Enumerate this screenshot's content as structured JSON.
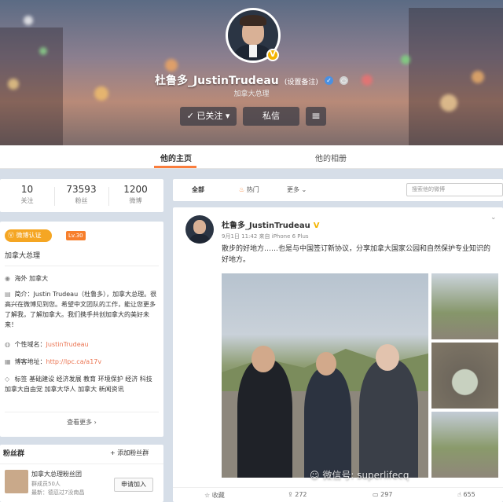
{
  "profile": {
    "name": "杜鲁多_JustinTrudeau",
    "remark": "(设置备注)",
    "description": "加拿大总理",
    "follow_button": "已关注",
    "message_button": "私信",
    "menu_icon": "menu-icon"
  },
  "tabs": {
    "home": "他的主页",
    "album": "他的相册"
  },
  "stats": [
    {
      "value": "10",
      "label": "关注"
    },
    {
      "value": "73593",
      "label": "粉丝"
    },
    {
      "value": "1200",
      "label": "微博"
    }
  ],
  "info": {
    "verify_badge": "微博认证",
    "level": "Lv.30",
    "verified_title": "加拿大总理",
    "location": "海外 加拿大",
    "bio": "简介：Justin Trudeau（杜鲁多），加拿大总理。很高兴在微博见到您。希望中文团队的工作，能让您更多了解我，了解加拿大。我们携手共创加拿大的美好未来！",
    "domain_label": "个性域名：",
    "domain_value": "JustinTrudeau",
    "blog_label": "博客地址：",
    "blog_value": "http://lpc.ca/a17v",
    "tags": "标签 基础建设 经济发展 教育 环境保护 经济 科技 加拿大自由党 加拿大华人 加拿大 新闻资讯",
    "more": "查看更多 ›"
  },
  "fans": {
    "title": "粉丝群",
    "add": "+ 添加粉丝群",
    "group_name": "加拿大总理粉丝团",
    "members": "群成员50人",
    "latest": "最新：德忍过7没南昌",
    "join": "申请加入"
  },
  "filter": {
    "all": "全部",
    "hot": "热门",
    "more": "更多",
    "search_placeholder": "搜索他的微博"
  },
  "post": {
    "author": "杜鲁多_JustinTrudeau",
    "verified": "V",
    "time": "9月1日 11:42 来自 iPhone 6 Plus",
    "text": "散步的好地方……也是与中国签订新协议，分享加拿大国家公园和自然保护专业知识的好地方。",
    "watermark": "微信号: superlifecq",
    "actions": {
      "favorite": "收藏",
      "forward": "272",
      "comment": "297",
      "like": "655"
    }
  }
}
